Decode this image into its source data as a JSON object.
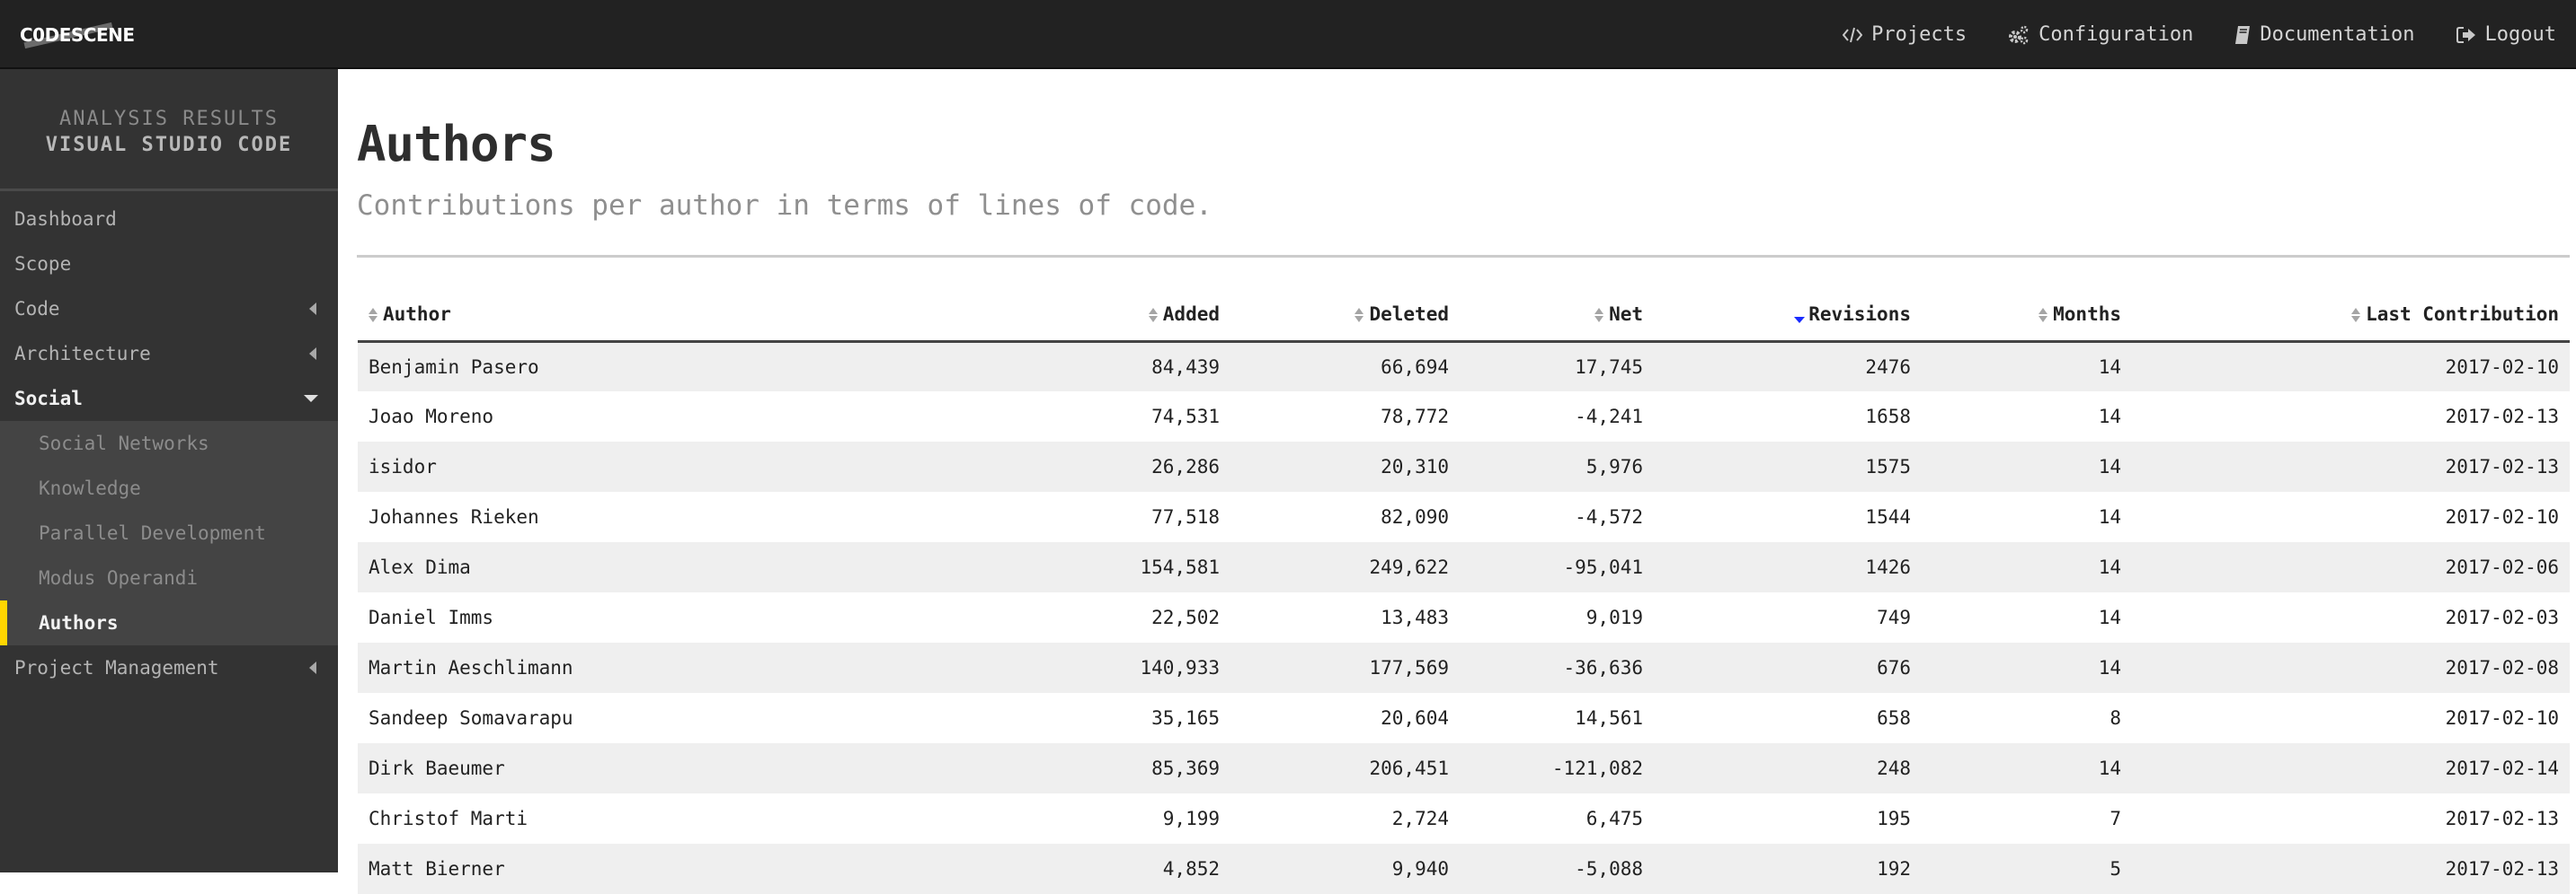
{
  "app": {
    "logo_text": "C0DESCENE"
  },
  "nav": [
    {
      "label": "Projects",
      "icon": "code-icon"
    },
    {
      "label": "Configuration",
      "icon": "gears-icon"
    },
    {
      "label": "Documentation",
      "icon": "book-icon"
    },
    {
      "label": "Logout",
      "icon": "sign-out-icon"
    }
  ],
  "sidebar": {
    "heading": "ANALYSIS RESULTS",
    "project": "VISUAL STUDIO CODE",
    "items": [
      {
        "label": "Dashboard",
        "expandable": false
      },
      {
        "label": "Scope",
        "expandable": false
      },
      {
        "label": "Code",
        "expandable": true,
        "expanded": false
      },
      {
        "label": "Architecture",
        "expandable": true,
        "expanded": false
      },
      {
        "label": "Social",
        "expandable": true,
        "expanded": true
      },
      {
        "label": "Project Management",
        "expandable": true,
        "expanded": false
      }
    ],
    "social_children": [
      {
        "label": "Social Networks"
      },
      {
        "label": "Knowledge"
      },
      {
        "label": "Parallel Development"
      },
      {
        "label": "Modus Operandi"
      },
      {
        "label": "Authors",
        "current": true
      }
    ],
    "accent_color": "#ffd600"
  },
  "page": {
    "title": "Authors",
    "subtitle": "Contributions per author in terms of lines of code."
  },
  "table": {
    "columns": [
      {
        "label": "Author",
        "sort": "none"
      },
      {
        "label": "Added",
        "sort": "none"
      },
      {
        "label": "Deleted",
        "sort": "none"
      },
      {
        "label": "Net",
        "sort": "none"
      },
      {
        "label": "Revisions",
        "sort": "descending"
      },
      {
        "label": "Months",
        "sort": "none"
      },
      {
        "label": "Last Contribution",
        "sort": "none"
      }
    ],
    "sort_active_color": "#1a2cff",
    "rows": [
      [
        "Benjamin Pasero",
        "84,439",
        "66,694",
        "17,745",
        "2476",
        "14",
        "2017-02-10"
      ],
      [
        "Joao Moreno",
        "74,531",
        "78,772",
        "-4,241",
        "1658",
        "14",
        "2017-02-13"
      ],
      [
        "isidor",
        "26,286",
        "20,310",
        "5,976",
        "1575",
        "14",
        "2017-02-13"
      ],
      [
        "Johannes Rieken",
        "77,518",
        "82,090",
        "-4,572",
        "1544",
        "14",
        "2017-02-10"
      ],
      [
        "Alex Dima",
        "154,581",
        "249,622",
        "-95,041",
        "1426",
        "14",
        "2017-02-06"
      ],
      [
        "Daniel Imms",
        "22,502",
        "13,483",
        "9,019",
        "749",
        "14",
        "2017-02-03"
      ],
      [
        "Martin Aeschlimann",
        "140,933",
        "177,569",
        "-36,636",
        "676",
        "14",
        "2017-02-08"
      ],
      [
        "Sandeep Somavarapu",
        "35,165",
        "20,604",
        "14,561",
        "658",
        "8",
        "2017-02-10"
      ],
      [
        "Dirk Baeumer",
        "85,369",
        "206,451",
        "-121,082",
        "248",
        "14",
        "2017-02-14"
      ],
      [
        "Christof Marti",
        "9,199",
        "2,724",
        "6,475",
        "195",
        "7",
        "2017-02-13"
      ],
      [
        "Matt Bierner",
        "4,852",
        "9,940",
        "-5,088",
        "192",
        "5",
        "2017-02-13"
      ]
    ]
  }
}
